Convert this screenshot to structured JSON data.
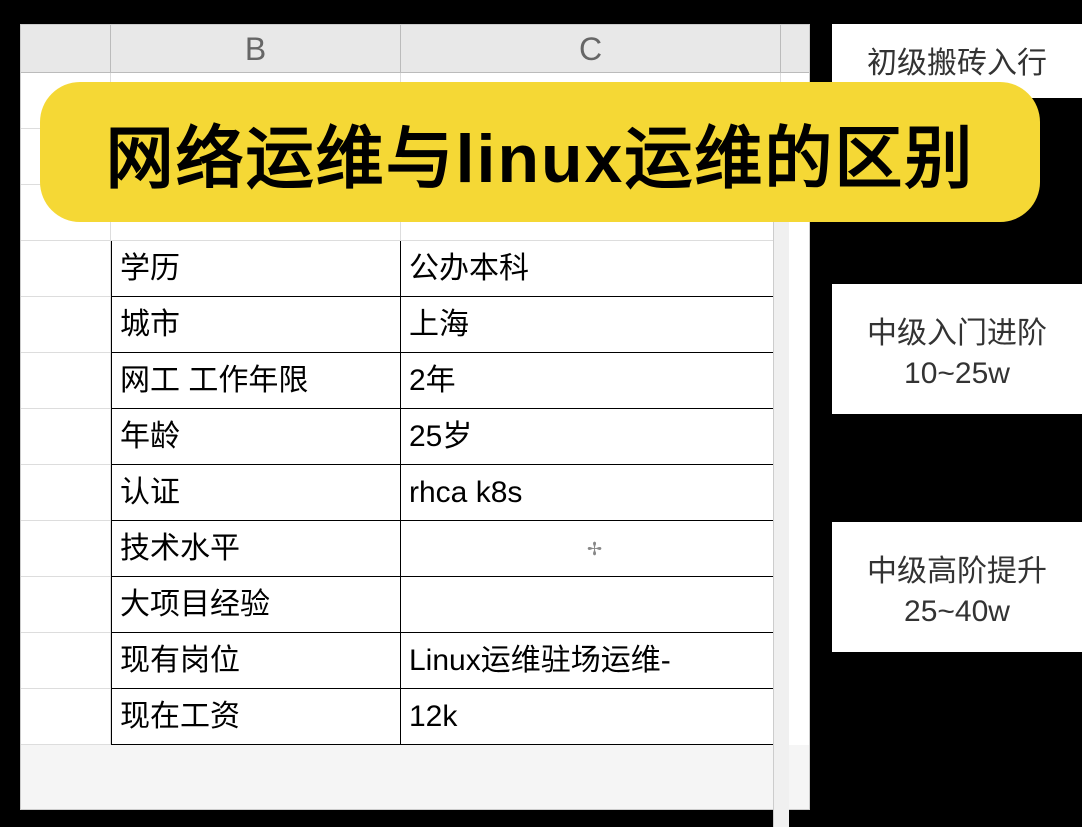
{
  "title": "网络运维与linux运维的区别",
  "columns": {
    "b": "B",
    "c": "C"
  },
  "rows": [
    {
      "label": "学历",
      "value": "公办本科"
    },
    {
      "label": "城市",
      "value": "上海"
    },
    {
      "label": "网工 工作年限",
      "value": "2年"
    },
    {
      "label": "年龄",
      "value": "25岁"
    },
    {
      "label": "认证",
      "value": "rhca k8s"
    },
    {
      "label": "技术水平",
      "value": ""
    },
    {
      "label": "大项目经验",
      "value": ""
    },
    {
      "label": "现有岗位",
      "value": "Linux运维驻场运维-"
    },
    {
      "label": "现在工资",
      "value": "12k"
    }
  ],
  "cursor_indicator": "✢",
  "right_cards": [
    {
      "line1": "初级搬砖入行",
      "line2": ""
    },
    {
      "line1": "中级入门进阶",
      "line2": "10~25w"
    },
    {
      "line1": "中级高阶提升",
      "line2": "25~40w"
    }
  ]
}
